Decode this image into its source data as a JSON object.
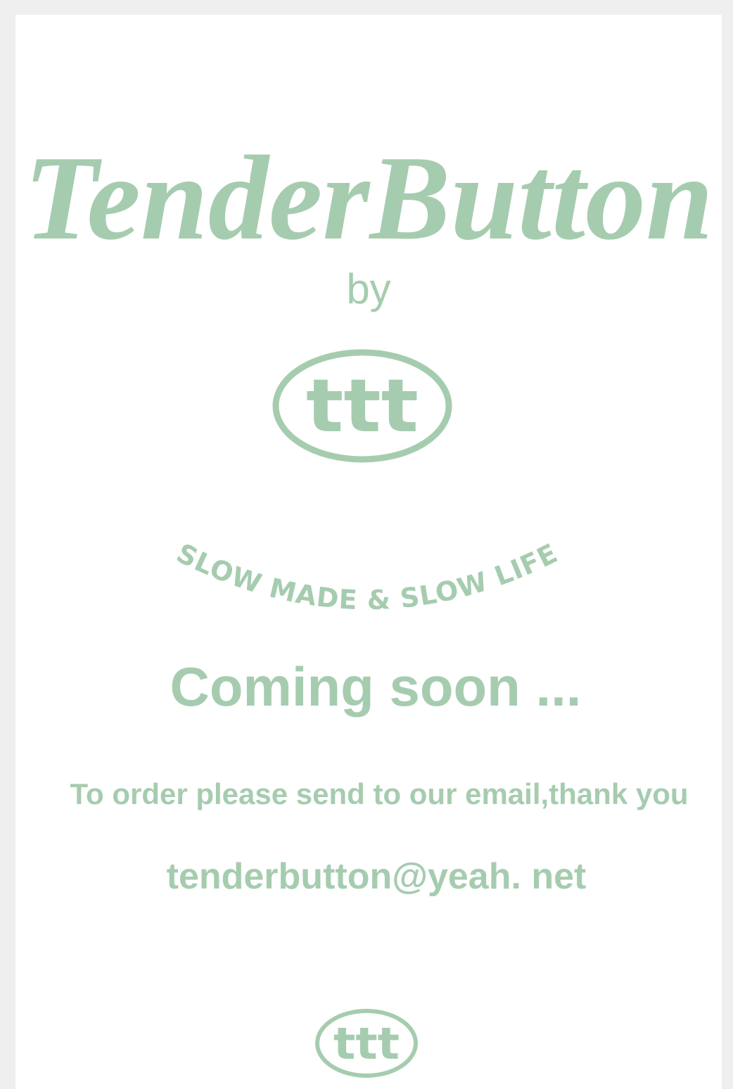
{
  "brand": {
    "name": "TenderButton",
    "by": "by",
    "logo_text": "ttt",
    "tagline": "SLOW MADE & SLOW LIFE"
  },
  "main": {
    "coming_soon": "Coming soon ...",
    "order_note": "To order please send to our email,thank you",
    "email": "tenderbutton@yeah. net"
  },
  "footer": {
    "logo_text": "ttt"
  },
  "colors": {
    "accent": "#a6ccaf",
    "page_bg": "#ffffff",
    "frame_bg": "#efefef"
  }
}
